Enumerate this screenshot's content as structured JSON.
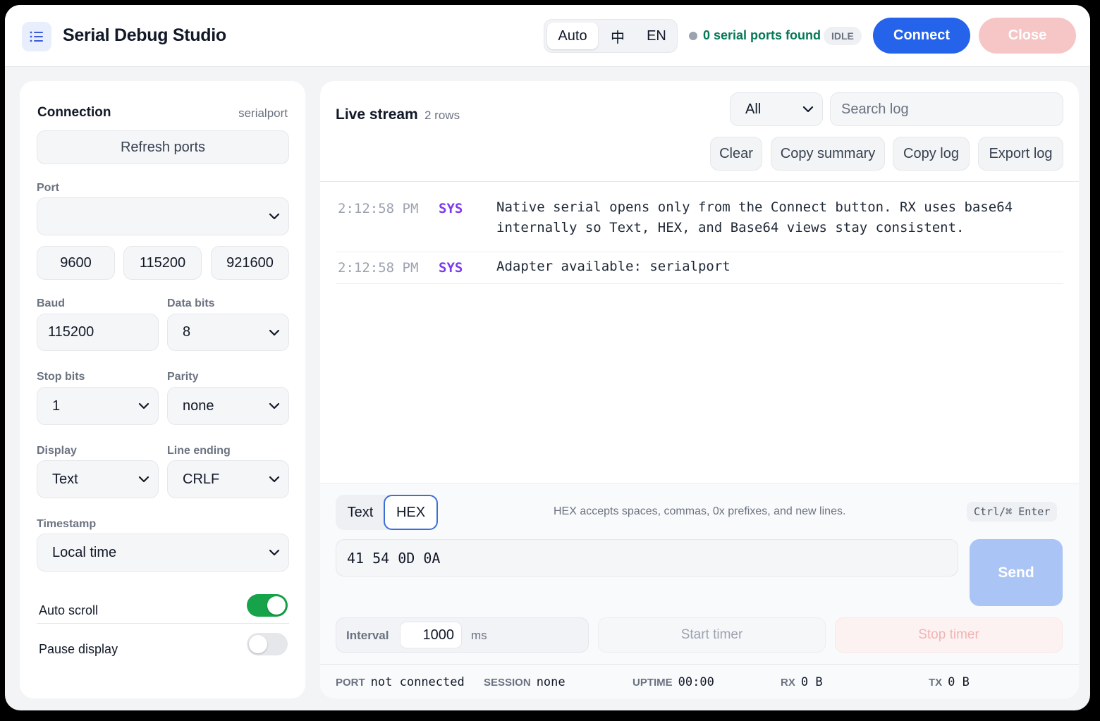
{
  "app": {
    "title": "Serial Debug Studio"
  },
  "header": {
    "languages": [
      "Auto",
      "中",
      "EN"
    ],
    "status_text": "0 serial ports found",
    "state_badge": "IDLE",
    "connect_label": "Connect",
    "close_label": "Close"
  },
  "connection": {
    "title": "Connection",
    "adapter": "serialport",
    "refresh_label": "Refresh ports",
    "port_label": "Port",
    "port_value": "",
    "baud_presets": [
      "9600",
      "115200",
      "921600"
    ],
    "baud_label": "Baud",
    "baud_value": "115200",
    "data_bits_label": "Data bits",
    "data_bits_value": "8",
    "stop_bits_label": "Stop bits",
    "stop_bits_value": "1",
    "parity_label": "Parity",
    "parity_value": "none",
    "display_label": "Display",
    "display_value": "Text",
    "line_ending_label": "Line ending",
    "line_ending_value": "CRLF",
    "timestamp_label": "Timestamp",
    "timestamp_value": "Local time",
    "auto_scroll_label": "Auto scroll",
    "auto_scroll_on": true,
    "pause_display_label": "Pause display",
    "pause_display_on": false
  },
  "stream": {
    "title": "Live stream",
    "row_count": "2 rows",
    "filter_value": "All",
    "search_placeholder": "Search log",
    "actions": [
      "Clear",
      "Copy summary",
      "Copy log",
      "Export log"
    ],
    "rows": [
      {
        "time": "2:12:58 PM",
        "source": "SYS",
        "line1": "Native serial opens only from the Connect button. RX uses base64",
        "line2": "internally so Text, HEX, and Base64 views stay consistent."
      },
      {
        "time": "2:12:58 PM",
        "source": "SYS",
        "line1": "Adapter available: serialport"
      }
    ]
  },
  "composer": {
    "modes": [
      "Text",
      "HEX"
    ],
    "active_mode": "HEX",
    "hint": "HEX accepts spaces, commas, 0x prefixes, and new lines.",
    "shortcut": "Ctrl/⌘ Enter",
    "input_value": "41 54 0D 0A",
    "send_label": "Send",
    "interval_label": "Interval",
    "interval_value": "1000",
    "interval_unit": "ms",
    "start_timer_label": "Start timer",
    "stop_timer_label": "Stop timer"
  },
  "footer": {
    "port_key": "PORT",
    "port_val": "not connected",
    "session_key": "SESSION",
    "session_val": "none",
    "uptime_key": "UPTIME",
    "uptime_val": "00:00",
    "rx_key": "RX",
    "rx_val": "0 B",
    "tx_key": "TX",
    "tx_val": "0 B"
  },
  "colors": {
    "primary": "#2563eb",
    "danger_disabled": "#f6c5c5",
    "toggle_on": "#16a34a",
    "status_ok": "#047857",
    "sys_tag": "#7c3aed"
  }
}
